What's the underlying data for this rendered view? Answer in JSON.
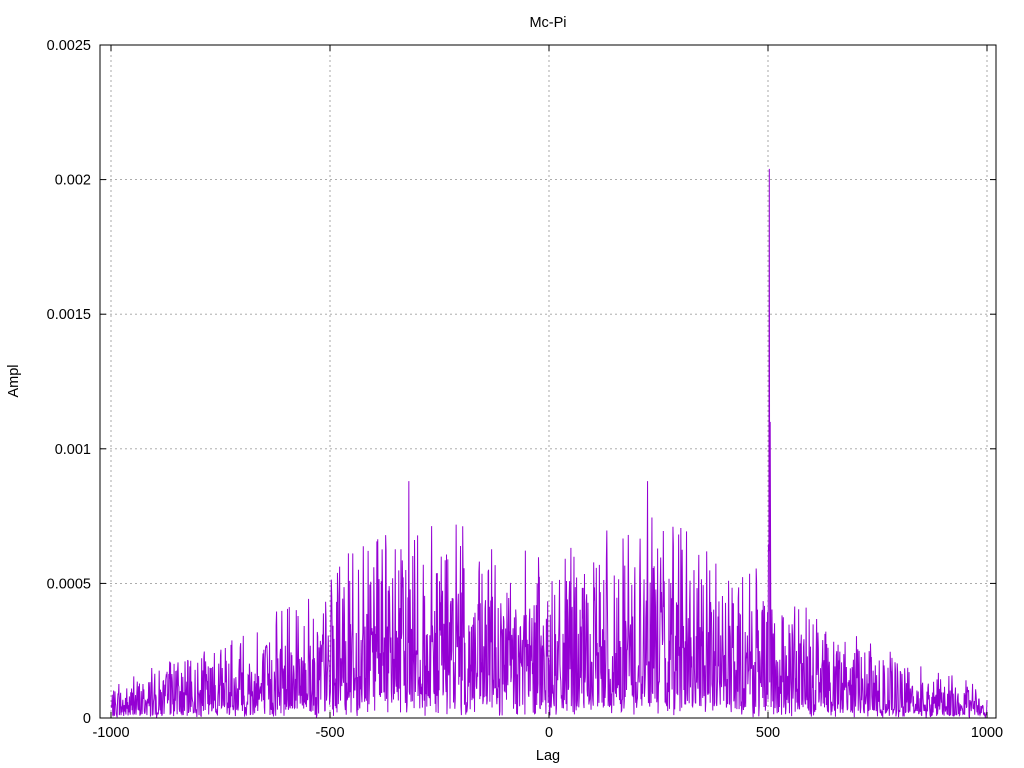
{
  "chart_data": {
    "type": "line",
    "title": "Mc-Pi",
    "xlabel": "Lag",
    "ylabel": "Ampl",
    "xlim": [
      -1000,
      1000
    ],
    "ylim": [
      0,
      0.0025
    ],
    "xticks": [
      -1000,
      -500,
      0,
      500,
      1000
    ],
    "xtick_labels": [
      "-1000",
      "-500",
      "0",
      "500",
      "1000"
    ],
    "yticks": [
      0,
      0.0005,
      0.001,
      0.0015,
      0.002,
      0.0025
    ],
    "ytick_labels": [
      "0",
      "0.0005",
      "0.001",
      "0.0015",
      "0.002",
      "0.0025"
    ],
    "grid": true,
    "series_color": "#9400d3",
    "series": [
      {
        "x": [
          -1000,
          -950,
          -900,
          -850,
          -800,
          -750,
          -700,
          -650,
          -600,
          -550,
          -500,
          -450,
          -400,
          -350,
          -320,
          -300,
          -250,
          -200,
          -150,
          -100,
          -50,
          0,
          50,
          100,
          150,
          200,
          225,
          250,
          300,
          350,
          400,
          450,
          500,
          503,
          505,
          510,
          550,
          600,
          650,
          700,
          750,
          800,
          850,
          900,
          950,
          1000
        ],
        "y": [
          9e-05,
          0.00012,
          0.00015,
          0.00017,
          0.00019,
          0.0002,
          0.00022,
          0.00026,
          0.00029,
          0.00034,
          0.0004,
          0.00045,
          0.00048,
          0.0005,
          0.00088,
          0.00053,
          0.00052,
          0.0005,
          0.00049,
          0.00047,
          0.00045,
          0.0004,
          0.00045,
          0.00048,
          0.0005,
          0.00052,
          0.00088,
          0.00051,
          0.0005,
          0.00047,
          0.00044,
          0.0004,
          0.00038,
          0.00204,
          0.0011,
          0.00034,
          0.00031,
          0.00028,
          0.00025,
          0.00022,
          0.00019,
          0.00016,
          0.00014,
          0.00012,
          0.0001,
          8e-05
        ]
      }
    ]
  }
}
